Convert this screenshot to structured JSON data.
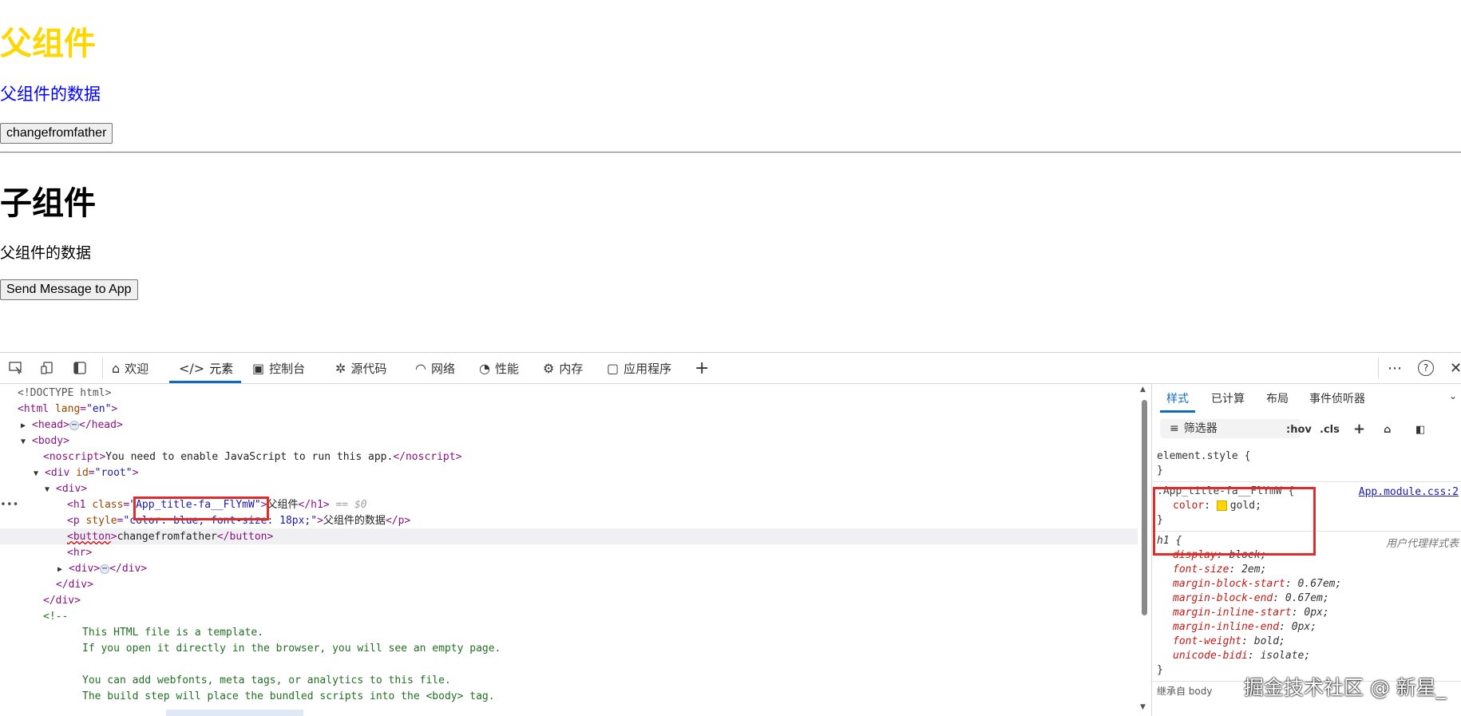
{
  "preview": {
    "father_title": "父组件",
    "father_text": "父组件的数据",
    "father_button": "changefromfather",
    "child_title": "子组件",
    "child_text": "父组件的数据",
    "child_button": "Send Message to App"
  },
  "devtools": {
    "tabs": [
      {
        "label": "欢迎",
        "icon": "home-icon"
      },
      {
        "label": "元素",
        "icon": "code-icon"
      },
      {
        "label": "控制台",
        "icon": "console-icon"
      },
      {
        "label": "源代码",
        "icon": "bug-icon"
      },
      {
        "label": "网络",
        "icon": "wifi-icon"
      },
      {
        "label": "性能",
        "icon": "gauge-icon"
      },
      {
        "label": "内存",
        "icon": "chip-icon"
      },
      {
        "label": "应用程序",
        "icon": "app-window-icon"
      }
    ],
    "active_tab": "元素",
    "dom": {
      "doctype": "<!DOCTYPE html>",
      "html_tag": "html",
      "html_attr": "lang",
      "html_val": "\"en\"",
      "head": "head",
      "body": "body",
      "noscript_text": "You need to enable JavaScript to run this app.",
      "root_id": "\"root\"",
      "h1_class": "App_title-fa__FlYmW",
      "h1_text": "父组件",
      "h1_marker": "== $0",
      "p_style": "\"color: blue; font-size: 18px;\"",
      "p_text": "父组件的数据",
      "button_text": "changefromfather",
      "comment_open": "<!--",
      "comment_lines": [
        "This HTML file is a template.",
        "If you open it directly in the browser, you will see an empty page.",
        "",
        "You can add webfonts, meta tags, or analytics to this file.",
        "The build step will place the bundled scripts into the <body> tag."
      ]
    },
    "styles": {
      "tabs": [
        "样式",
        "已计算",
        "布局",
        "事件侦听器"
      ],
      "filter_placeholder": "筛选器",
      "hov": ":hov",
      "cls": ".cls",
      "element_style": "element.style {",
      "close_brace": "}",
      "rule_selector": ".App_title-fa__FlYmW {",
      "rule_source": "App.module.css:2",
      "rule_prop": "color",
      "rule_value": "gold;",
      "swatch_color": "#ffd700",
      "ua_selector": "h1 {",
      "ua_source": "用户代理样式表",
      "ua_props": [
        {
          "name": "display",
          "value": "block;"
        },
        {
          "name": "font-size",
          "value": "2em;"
        },
        {
          "name": "margin-block-start",
          "value": "0.67em;"
        },
        {
          "name": "margin-block-end",
          "value": "0.67em;"
        },
        {
          "name": "margin-inline-start",
          "value": "0px;"
        },
        {
          "name": "margin-inline-end",
          "value": "0px;"
        },
        {
          "name": "font-weight",
          "value": "bold;"
        },
        {
          "name": "unicode-bidi",
          "value": "isolate;"
        }
      ],
      "inherited": "继承自 body"
    }
  },
  "watermark": "掘金技术社区 @ 新星_"
}
